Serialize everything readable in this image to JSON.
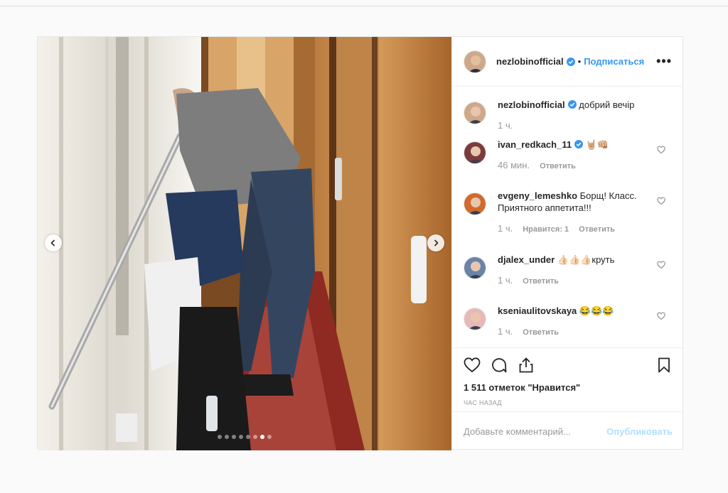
{
  "post": {
    "author": "nezlobinofficial",
    "separator": "•",
    "follow_label": "Подписаться",
    "more_label": "•••",
    "carousel_total": 8,
    "carousel_active": 7
  },
  "comments": [
    {
      "user": "nezlobinofficial",
      "verified": true,
      "text": "добрий вечір",
      "time": "1 ч.",
      "likes": "",
      "reply": "",
      "heart": false
    },
    {
      "user": "ivan_redkach_11",
      "verified": true,
      "text": "🤘🏼👊🏼",
      "time": "46 мин.",
      "likes": "",
      "reply": "Ответить",
      "heart": true
    },
    {
      "user": "evgeny_lemeshko",
      "verified": false,
      "text": "Борщ! Класс. Приятного аппетита!!!",
      "time": "1 ч.",
      "likes": "Нравится: 1",
      "reply": "Ответить",
      "heart": true
    },
    {
      "user": "djalex_under",
      "verified": false,
      "text": "👍🏻👍🏻👍🏻круть",
      "time": "1 ч.",
      "likes": "",
      "reply": "Ответить",
      "heart": true
    },
    {
      "user": "kseniaulitovskaya",
      "verified": false,
      "text": "😂😂😂",
      "time": "1 ч.",
      "likes": "",
      "reply": "Ответить",
      "heart": true
    }
  ],
  "actions": {
    "likes_text": "1 511 отметок \"Нравится\"",
    "time_ago": "ЧАС НАЗАД"
  },
  "add_comment": {
    "placeholder": "Добавьте комментарий...",
    "publish_label": "Опубликовать"
  },
  "colors": {
    "link": "#3897f0",
    "verified": "#3897f0",
    "publish_disabled": "#b2dffc"
  }
}
